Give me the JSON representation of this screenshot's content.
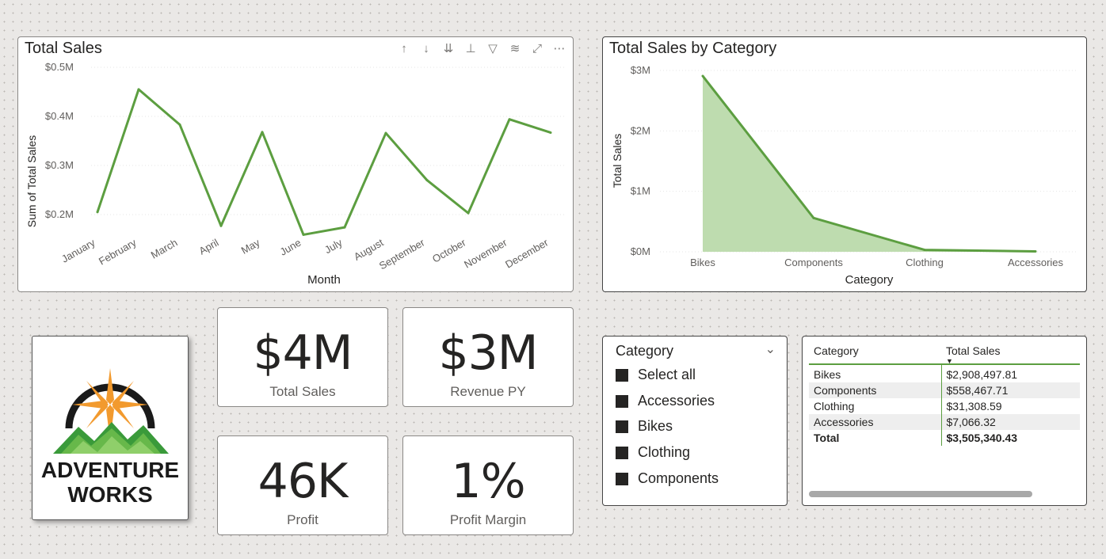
{
  "total_sales_chart": {
    "title": "Total Sales",
    "toolbar_icons": [
      "drill-up-icon",
      "drill-down-icon",
      "expand-down-icon",
      "hierarchy-icon",
      "filter-icon",
      "focus-icon",
      "expand-icon",
      "more-options-icon"
    ],
    "accent": "#5c9e40"
  },
  "category_chart": {
    "title": "Total Sales by Category",
    "accent": "#5c9e40",
    "fill": "#bedcaf"
  },
  "chart_data": [
    {
      "type": "line",
      "title": "Total Sales",
      "xlabel": "Month",
      "ylabel": "Sum of Total Sales",
      "categories": [
        "January",
        "February",
        "March",
        "April",
        "May",
        "June",
        "July",
        "August",
        "September",
        "October",
        "November",
        "December"
      ],
      "values": [
        205000,
        455000,
        383000,
        177000,
        368000,
        159000,
        174000,
        366000,
        270000,
        203000,
        394000,
        367000
      ],
      "yticks": [
        "$0.2M",
        "$0.3M",
        "$0.4M",
        "$0.5M"
      ],
      "ylim": [
        0.15,
        0.5
      ],
      "grid": true
    },
    {
      "type": "area",
      "title": "Total Sales by Category",
      "xlabel": "Category",
      "ylabel": "Total Sales",
      "categories": [
        "Bikes",
        "Components",
        "Clothing",
        "Accessories"
      ],
      "values": [
        2908497.81,
        558467.71,
        31308.59,
        7066.32
      ],
      "yticks": [
        "$0M",
        "$1M",
        "$2M",
        "$3M"
      ],
      "ylim": [
        0,
        3
      ],
      "grid": true
    }
  ],
  "kpis": [
    {
      "value": "$4M",
      "label": "Total Sales"
    },
    {
      "value": "$3M",
      "label": "Revenue PY"
    },
    {
      "value": "46K",
      "label": "Profit"
    },
    {
      "value": "1%",
      "label": "Profit Margin"
    }
  ],
  "logo": {
    "line1": "Adventure",
    "line2": "Works"
  },
  "slicer": {
    "title": "Category",
    "items": [
      "Select all",
      "Accessories",
      "Bikes",
      "Clothing",
      "Components"
    ]
  },
  "table": {
    "headers": [
      "Category",
      "Total Sales"
    ],
    "rows": [
      [
        "Bikes",
        "$2,908,497.81"
      ],
      [
        "Components",
        "$558,467.71"
      ],
      [
        "Clothing",
        "$31,308.59"
      ],
      [
        "Accessories",
        "$7,066.32"
      ]
    ],
    "total": [
      "Total",
      "$3,505,340.43"
    ]
  }
}
